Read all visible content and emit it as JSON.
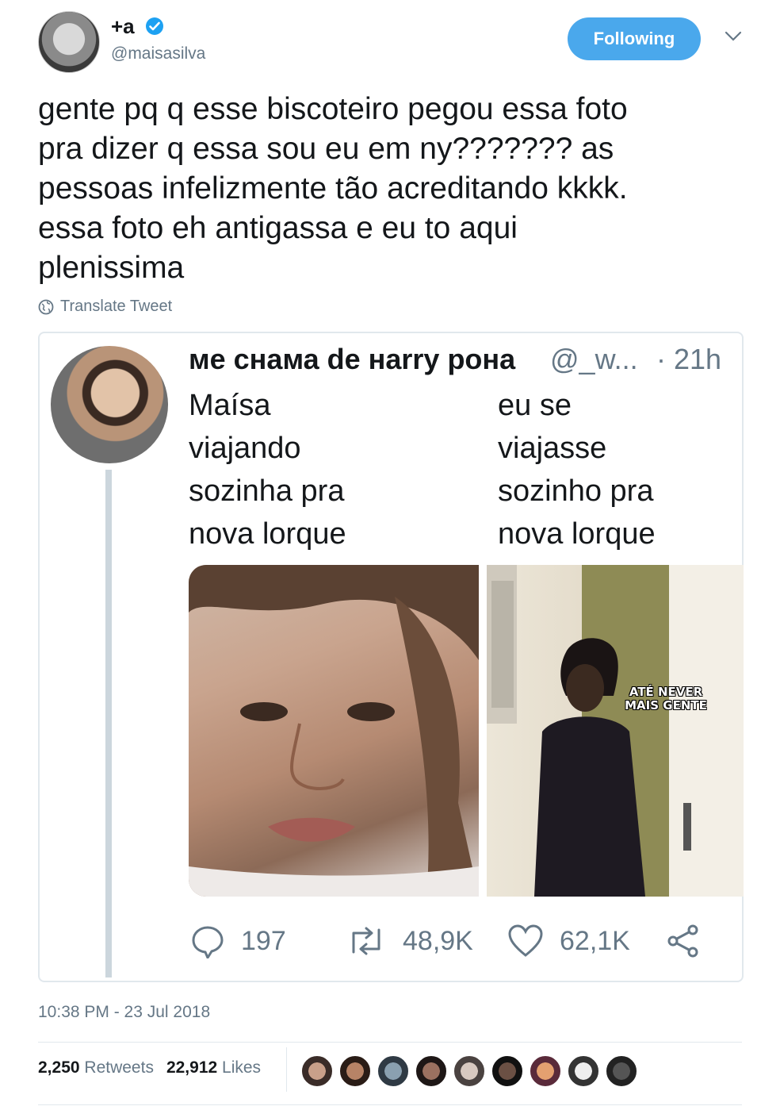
{
  "author": {
    "display_name": "+a",
    "handle": "@maisasilva"
  },
  "follow_button": {
    "label": "Following",
    "color": "#4aa8ec"
  },
  "tweet": {
    "text": "gente pq q esse biscoteiro pegou essa foto\npra dizer q essa sou eu em ny??????? as\npessoas infelizmente tão acreditando kkkk.\nessa foto eh antigassa e eu to aqui\nplenissima",
    "translate_label": "Translate Tweet"
  },
  "quoted": {
    "display_name": "ме снама de нarry рона",
    "handle": "@_w...",
    "time": "· 21h",
    "left_caption": [
      "Maísa",
      "viajando",
      "sozinha pra",
      "nova lorque"
    ],
    "right_caption": [
      "eu se",
      "viajasse",
      "sozinho pra",
      "nova lorque"
    ],
    "meme_text_line1": "ATÉ NEVER",
    "meme_text_line2": "MAIS GENTE",
    "replies": "197",
    "retweets": "48,9K",
    "likes": "62,1K"
  },
  "timestamp": "10:38 PM - 23 Jul 2018",
  "stats": {
    "retweets_count": "2,250",
    "retweets_label": "Retweets",
    "likes_count": "22,912",
    "likes_label": "Likes"
  },
  "likers": [
    "liker-1",
    "liker-2",
    "liker-3",
    "liker-4",
    "liker-5",
    "liker-6",
    "liker-7",
    "liker-8",
    "liker-9"
  ],
  "colors": {
    "accent": "#1da1f2",
    "muted": "#657786",
    "border": "#e1e8ed"
  }
}
